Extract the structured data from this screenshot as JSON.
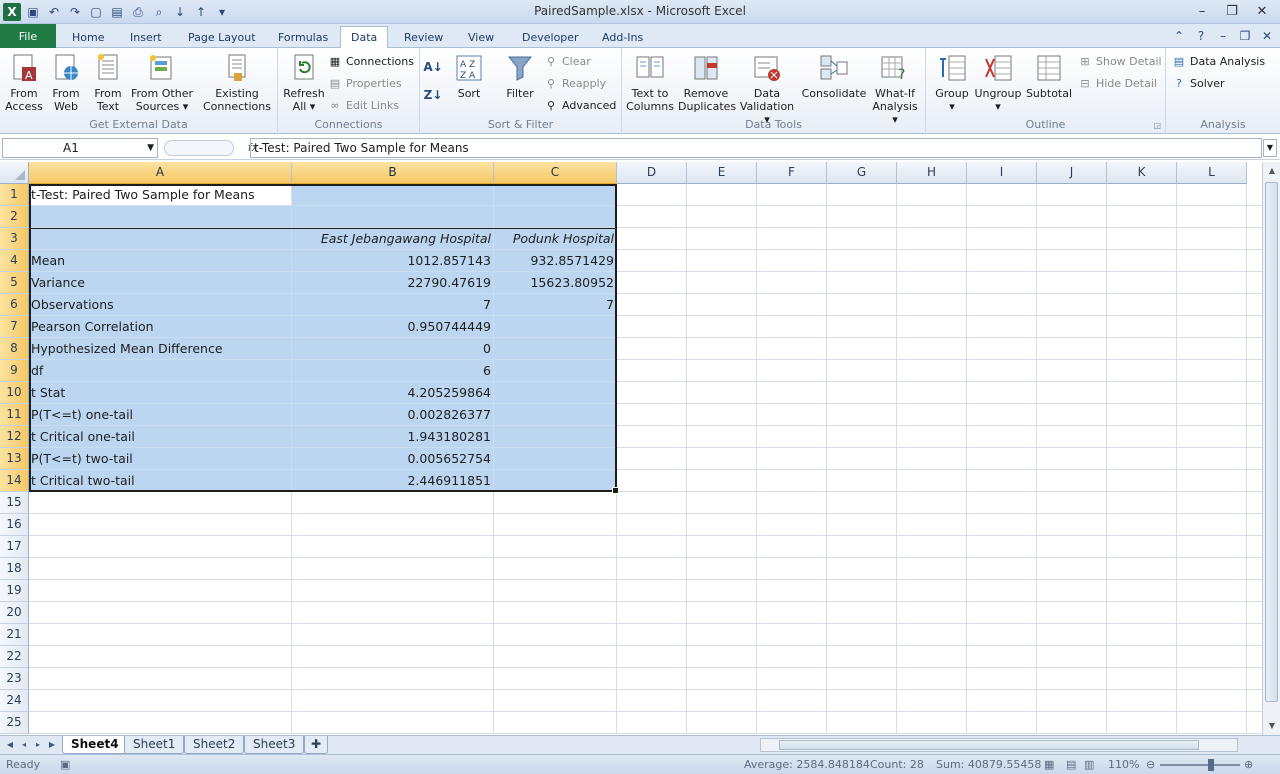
{
  "window": {
    "title": "PairedSample.xlsx - Microsoft Excel"
  },
  "tabs": [
    {
      "label": "File"
    },
    {
      "label": "Home"
    },
    {
      "label": "Insert"
    },
    {
      "label": "Page Layout"
    },
    {
      "label": "Formulas"
    },
    {
      "label": "Data"
    },
    {
      "label": "Review"
    },
    {
      "label": "View"
    },
    {
      "label": "Developer"
    },
    {
      "label": "Add-Ins"
    }
  ],
  "ribbon": {
    "get_external": {
      "label": "Get External Data",
      "from_access": "From\nAccess",
      "from_web": "From\nWeb",
      "from_text": "From\nText",
      "from_other": "From Other\nSources ▾",
      "existing": "Existing\nConnections"
    },
    "connections": {
      "label": "Connections",
      "refresh": "Refresh\nAll ▾",
      "connections": "Connections",
      "properties": "Properties",
      "edit_links": "Edit Links"
    },
    "sort_filter": {
      "label": "Sort & Filter",
      "sort": "Sort",
      "filter": "Filter",
      "clear": "Clear",
      "reapply": "Reapply",
      "advanced": "Advanced"
    },
    "data_tools": {
      "label": "Data Tools",
      "text_to_columns": "Text to\nColumns",
      "remove_duplicates": "Remove\nDuplicates",
      "data_validation": "Data\nValidation ▾",
      "consolidate": "Consolidate",
      "what_if": "What-If\nAnalysis ▾"
    },
    "outline": {
      "label": "Outline",
      "group": "Group\n▾",
      "ungroup": "Ungroup\n▾",
      "subtotal": "Subtotal",
      "show_detail": "Show Detail",
      "hide_detail": "Hide Detail"
    },
    "analysis": {
      "label": "Analysis",
      "data_analysis": "Data Analysis",
      "solver": "Solver"
    }
  },
  "formula_bar": {
    "name_box": "A1",
    "fx": "fx",
    "formula": "t-Test: Paired Two Sample for Means"
  },
  "columns": [
    "A",
    "B",
    "C",
    "D",
    "E",
    "F",
    "G",
    "H",
    "I",
    "J",
    "K",
    "L"
  ],
  "rows": [
    {
      "n": "1",
      "a": "t-Test: Paired Two Sample for Means",
      "b": "",
      "c": ""
    },
    {
      "n": "2",
      "a": "",
      "b": "",
      "c": ""
    },
    {
      "n": "3",
      "a": "",
      "b": "East Jebangawang Hospital",
      "c": "Podunk Hospital"
    },
    {
      "n": "4",
      "a": "Mean",
      "b": "1012.857143",
      "c": "932.8571429"
    },
    {
      "n": "5",
      "a": "Variance",
      "b": "22790.47619",
      "c": "15623.80952"
    },
    {
      "n": "6",
      "a": "Observations",
      "b": "7",
      "c": "7"
    },
    {
      "n": "7",
      "a": "Pearson Correlation",
      "b": "0.950744449",
      "c": ""
    },
    {
      "n": "8",
      "a": "Hypothesized Mean Difference",
      "b": "0",
      "c": ""
    },
    {
      "n": "9",
      "a": "df",
      "b": "6",
      "c": ""
    },
    {
      "n": "10",
      "a": "t Stat",
      "b": "4.205259864",
      "c": ""
    },
    {
      "n": "11",
      "a": "P(T<=t) one-tail",
      "b": "0.002826377",
      "c": ""
    },
    {
      "n": "12",
      "a": "t Critical one-tail",
      "b": "1.943180281",
      "c": ""
    },
    {
      "n": "13",
      "a": "P(T<=t) two-tail",
      "b": "0.005652754",
      "c": ""
    },
    {
      "n": "14",
      "a": "t Critical two-tail",
      "b": "2.446911851",
      "c": ""
    },
    {
      "n": "15",
      "a": "",
      "b": "",
      "c": ""
    },
    {
      "n": "16",
      "a": "",
      "b": "",
      "c": ""
    },
    {
      "n": "17",
      "a": "",
      "b": "",
      "c": ""
    },
    {
      "n": "18",
      "a": "",
      "b": "",
      "c": ""
    },
    {
      "n": "19",
      "a": "",
      "b": "",
      "c": ""
    },
    {
      "n": "20",
      "a": "",
      "b": "",
      "c": ""
    },
    {
      "n": "21",
      "a": "",
      "b": "",
      "c": ""
    },
    {
      "n": "22",
      "a": "",
      "b": "",
      "c": ""
    },
    {
      "n": "23",
      "a": "",
      "b": "",
      "c": ""
    },
    {
      "n": "24",
      "a": "",
      "b": "",
      "c": ""
    },
    {
      "n": "25",
      "a": "",
      "b": "",
      "c": ""
    }
  ],
  "sheets": [
    "Sheet4",
    "Sheet1",
    "Sheet2",
    "Sheet3"
  ],
  "status": {
    "ready": "Ready",
    "average": "Average: 2584.848184",
    "count": "Count: 28",
    "sum": "Sum: 40879.55458",
    "zoom": "110%"
  },
  "colors": {
    "accent": "#1f7a44",
    "selection": "#bcd6f2",
    "header_selected": "#f5c866"
  }
}
